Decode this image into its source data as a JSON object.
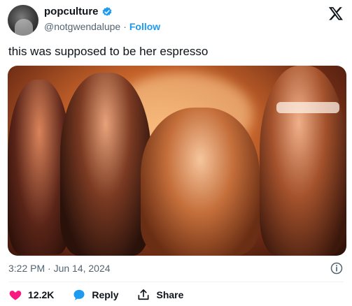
{
  "post": {
    "display_name": "popculture",
    "handle": "@notgwendalupe",
    "separator": "·",
    "follow_label": "Follow",
    "text": "this was supposed to be her espresso",
    "timestamp": "3:22 PM · Jun 14, 2024"
  },
  "actions": {
    "likes": "12.2K",
    "reply_label": "Reply",
    "share_label": "Share"
  },
  "colors": {
    "accent": "#1d9bf0",
    "like": "#f91880",
    "muted": "#536471"
  },
  "icons": [
    "verified-badge-icon",
    "x-logo-icon",
    "info-icon",
    "heart-icon",
    "reply-icon",
    "share-icon"
  ]
}
